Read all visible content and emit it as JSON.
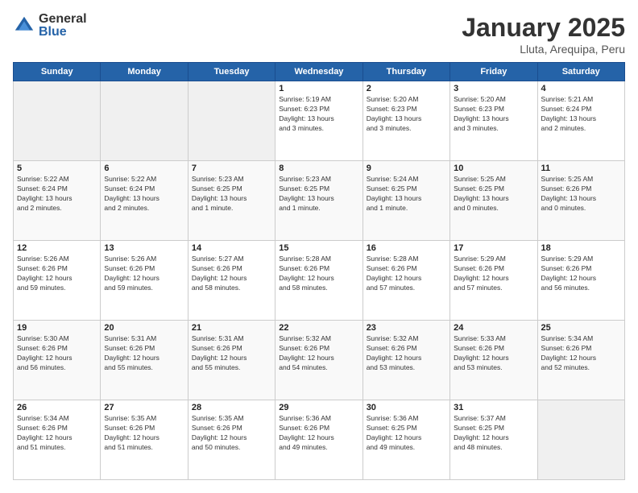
{
  "logo": {
    "general": "General",
    "blue": "Blue"
  },
  "header": {
    "title": "January 2025",
    "subtitle": "Lluta, Arequipa, Peru"
  },
  "weekdays": [
    "Sunday",
    "Monday",
    "Tuesday",
    "Wednesday",
    "Thursday",
    "Friday",
    "Saturday"
  ],
  "weeks": [
    [
      {
        "day": "",
        "detail": ""
      },
      {
        "day": "",
        "detail": ""
      },
      {
        "day": "",
        "detail": ""
      },
      {
        "day": "1",
        "detail": "Sunrise: 5:19 AM\nSunset: 6:23 PM\nDaylight: 13 hours\nand 3 minutes."
      },
      {
        "day": "2",
        "detail": "Sunrise: 5:20 AM\nSunset: 6:23 PM\nDaylight: 13 hours\nand 3 minutes."
      },
      {
        "day": "3",
        "detail": "Sunrise: 5:20 AM\nSunset: 6:23 PM\nDaylight: 13 hours\nand 3 minutes."
      },
      {
        "day": "4",
        "detail": "Sunrise: 5:21 AM\nSunset: 6:24 PM\nDaylight: 13 hours\nand 2 minutes."
      }
    ],
    [
      {
        "day": "5",
        "detail": "Sunrise: 5:22 AM\nSunset: 6:24 PM\nDaylight: 13 hours\nand 2 minutes."
      },
      {
        "day": "6",
        "detail": "Sunrise: 5:22 AM\nSunset: 6:24 PM\nDaylight: 13 hours\nand 2 minutes."
      },
      {
        "day": "7",
        "detail": "Sunrise: 5:23 AM\nSunset: 6:25 PM\nDaylight: 13 hours\nand 1 minute."
      },
      {
        "day": "8",
        "detail": "Sunrise: 5:23 AM\nSunset: 6:25 PM\nDaylight: 13 hours\nand 1 minute."
      },
      {
        "day": "9",
        "detail": "Sunrise: 5:24 AM\nSunset: 6:25 PM\nDaylight: 13 hours\nand 1 minute."
      },
      {
        "day": "10",
        "detail": "Sunrise: 5:25 AM\nSunset: 6:25 PM\nDaylight: 13 hours\nand 0 minutes."
      },
      {
        "day": "11",
        "detail": "Sunrise: 5:25 AM\nSunset: 6:26 PM\nDaylight: 13 hours\nand 0 minutes."
      }
    ],
    [
      {
        "day": "12",
        "detail": "Sunrise: 5:26 AM\nSunset: 6:26 PM\nDaylight: 12 hours\nand 59 minutes."
      },
      {
        "day": "13",
        "detail": "Sunrise: 5:26 AM\nSunset: 6:26 PM\nDaylight: 12 hours\nand 59 minutes."
      },
      {
        "day": "14",
        "detail": "Sunrise: 5:27 AM\nSunset: 6:26 PM\nDaylight: 12 hours\nand 58 minutes."
      },
      {
        "day": "15",
        "detail": "Sunrise: 5:28 AM\nSunset: 6:26 PM\nDaylight: 12 hours\nand 58 minutes."
      },
      {
        "day": "16",
        "detail": "Sunrise: 5:28 AM\nSunset: 6:26 PM\nDaylight: 12 hours\nand 57 minutes."
      },
      {
        "day": "17",
        "detail": "Sunrise: 5:29 AM\nSunset: 6:26 PM\nDaylight: 12 hours\nand 57 minutes."
      },
      {
        "day": "18",
        "detail": "Sunrise: 5:29 AM\nSunset: 6:26 PM\nDaylight: 12 hours\nand 56 minutes."
      }
    ],
    [
      {
        "day": "19",
        "detail": "Sunrise: 5:30 AM\nSunset: 6:26 PM\nDaylight: 12 hours\nand 56 minutes."
      },
      {
        "day": "20",
        "detail": "Sunrise: 5:31 AM\nSunset: 6:26 PM\nDaylight: 12 hours\nand 55 minutes."
      },
      {
        "day": "21",
        "detail": "Sunrise: 5:31 AM\nSunset: 6:26 PM\nDaylight: 12 hours\nand 55 minutes."
      },
      {
        "day": "22",
        "detail": "Sunrise: 5:32 AM\nSunset: 6:26 PM\nDaylight: 12 hours\nand 54 minutes."
      },
      {
        "day": "23",
        "detail": "Sunrise: 5:32 AM\nSunset: 6:26 PM\nDaylight: 12 hours\nand 53 minutes."
      },
      {
        "day": "24",
        "detail": "Sunrise: 5:33 AM\nSunset: 6:26 PM\nDaylight: 12 hours\nand 53 minutes."
      },
      {
        "day": "25",
        "detail": "Sunrise: 5:34 AM\nSunset: 6:26 PM\nDaylight: 12 hours\nand 52 minutes."
      }
    ],
    [
      {
        "day": "26",
        "detail": "Sunrise: 5:34 AM\nSunset: 6:26 PM\nDaylight: 12 hours\nand 51 minutes."
      },
      {
        "day": "27",
        "detail": "Sunrise: 5:35 AM\nSunset: 6:26 PM\nDaylight: 12 hours\nand 51 minutes."
      },
      {
        "day": "28",
        "detail": "Sunrise: 5:35 AM\nSunset: 6:26 PM\nDaylight: 12 hours\nand 50 minutes."
      },
      {
        "day": "29",
        "detail": "Sunrise: 5:36 AM\nSunset: 6:26 PM\nDaylight: 12 hours\nand 49 minutes."
      },
      {
        "day": "30",
        "detail": "Sunrise: 5:36 AM\nSunset: 6:25 PM\nDaylight: 12 hours\nand 49 minutes."
      },
      {
        "day": "31",
        "detail": "Sunrise: 5:37 AM\nSunset: 6:25 PM\nDaylight: 12 hours\nand 48 minutes."
      },
      {
        "day": "",
        "detail": ""
      }
    ]
  ]
}
